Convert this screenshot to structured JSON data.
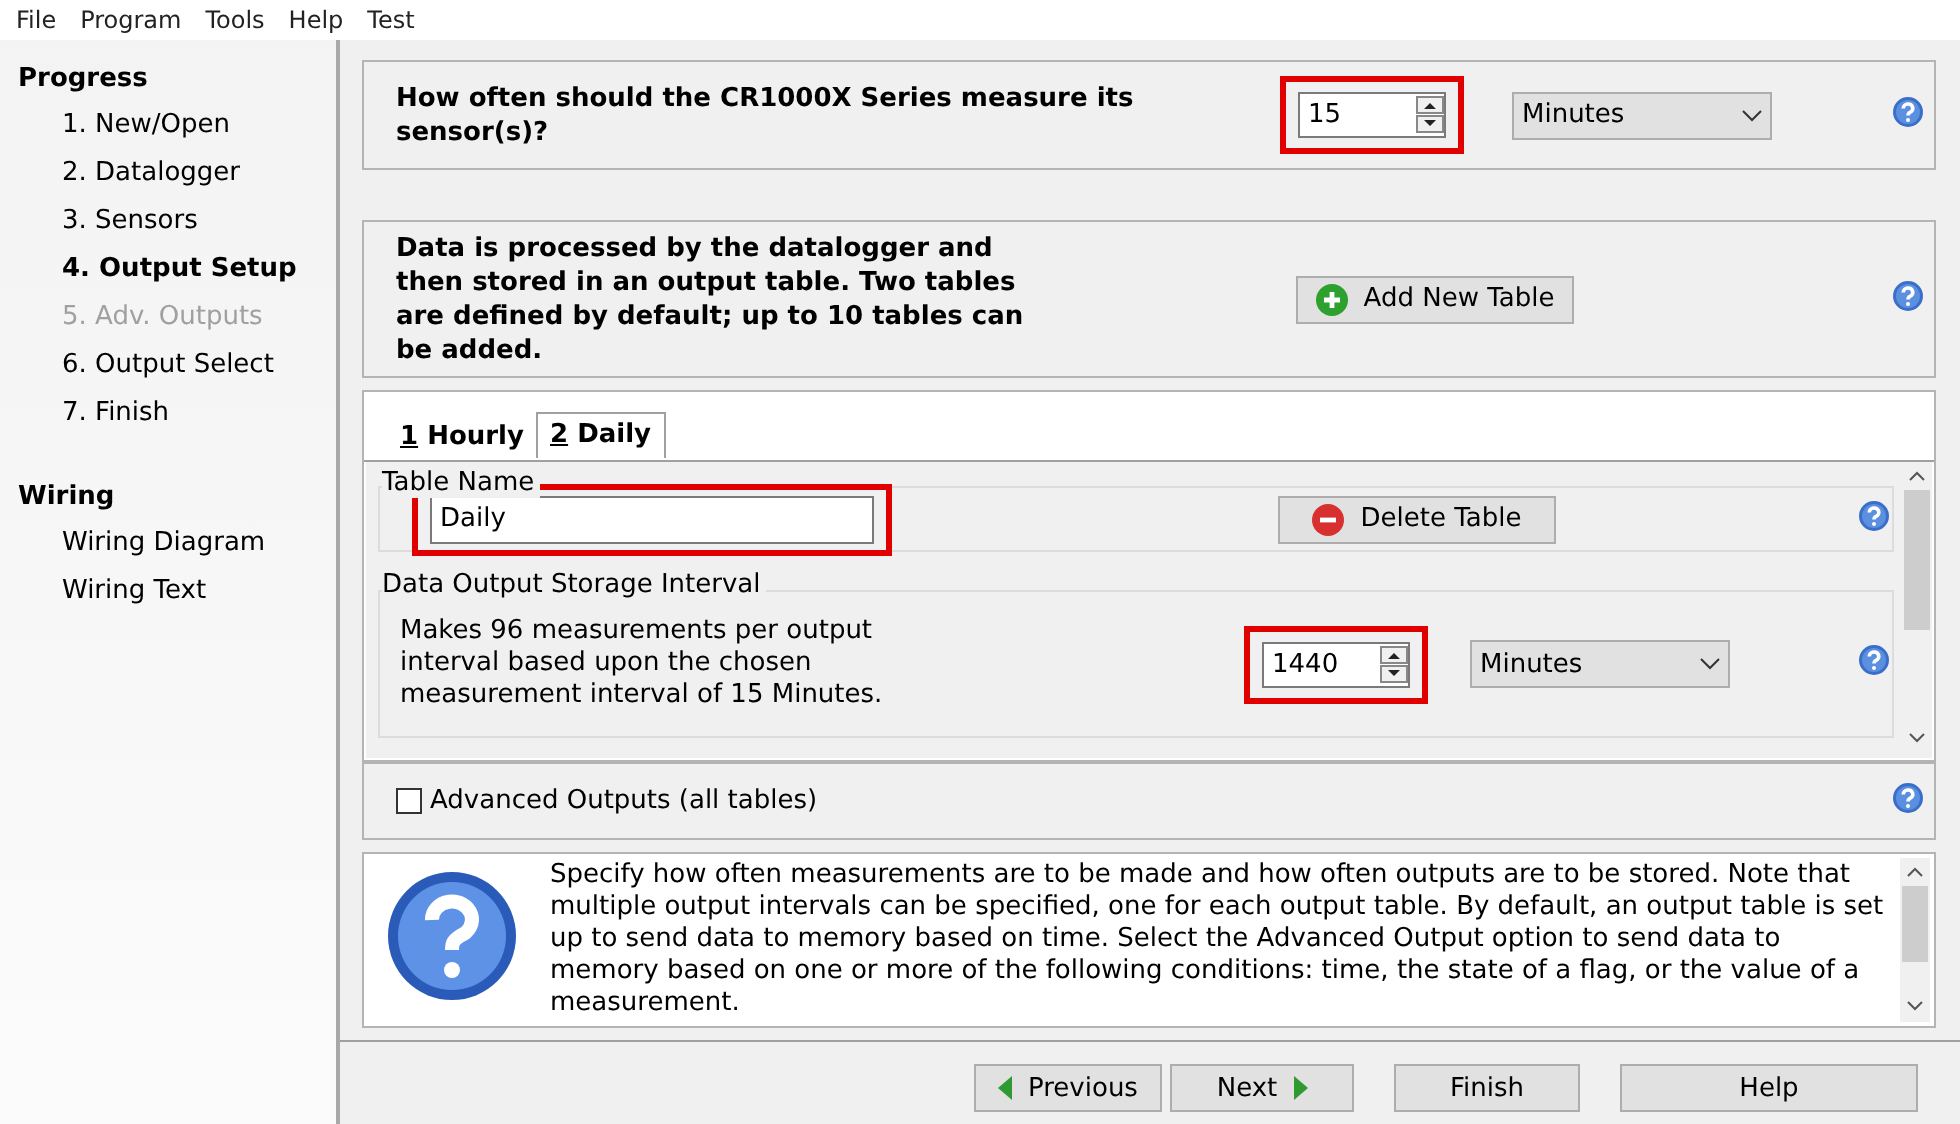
{
  "menu": [
    {
      "label": "File"
    },
    {
      "label": "Program"
    },
    {
      "label": "Tools"
    },
    {
      "label": "Help"
    },
    {
      "label": "Test"
    }
  ],
  "sidebar": {
    "sections": [
      {
        "title": "Progress",
        "items": [
          {
            "label": "1. New/Open",
            "selected": false,
            "disabled": false
          },
          {
            "label": "2. Datalogger",
            "selected": false,
            "disabled": false
          },
          {
            "label": "3. Sensors",
            "selected": false,
            "disabled": false
          },
          {
            "label": "4. Output Setup",
            "selected": true,
            "disabled": false
          },
          {
            "label": "5. Adv. Outputs",
            "selected": false,
            "disabled": true
          },
          {
            "label": "6. Output Select",
            "selected": false,
            "disabled": false
          },
          {
            "label": "7. Finish",
            "selected": false,
            "disabled": false
          }
        ]
      },
      {
        "title": "Wiring",
        "items": [
          {
            "label": "Wiring Diagram",
            "selected": false,
            "disabled": false
          },
          {
            "label": "Wiring Text",
            "selected": false,
            "disabled": false
          }
        ]
      }
    ]
  },
  "measurement": {
    "question": "How often should the CR1000X Series measure its sensor(s)?",
    "interval": {
      "value": "15",
      "highlighted": true
    },
    "units": "Minutes"
  },
  "tables_info": {
    "text": "Data is processed by the datalogger and then stored in an output table. Two tables are defined by default; up to 10 tables can be added.",
    "add_button": "Add New Table"
  },
  "tabs": [
    {
      "mnemonic": "1",
      "label": "Hourly",
      "selected": false
    },
    {
      "mnemonic": "2",
      "label": "Daily",
      "selected": true
    }
  ],
  "table_name": {
    "legend": "Table Name",
    "value": "Daily",
    "highlighted": true,
    "delete_button": "Delete Table"
  },
  "storage_interval": {
    "legend": "Data Output Storage Interval",
    "description": "Makes 96 measurements per output interval based upon the chosen measurement interval of 15 Minutes.",
    "interval": {
      "value": "1440",
      "highlighted": true
    },
    "units": "Minutes"
  },
  "advanced_outputs": {
    "label": "Advanced Outputs (all tables)",
    "checked": false
  },
  "help_text": "Specify how often measurements are to be made and how often outputs are to be stored. Note that multiple output intervals can be specified, one for each output table. By default, an output table is set up to send data to memory based on time. Select the Advanced Output option to send data to memory based on one or more of the following conditions: time, the state of a flag, or the value of a measurement.",
  "buttons": [
    {
      "kind": "previous",
      "label": "Previous"
    },
    {
      "kind": "next",
      "label": "Next"
    },
    {
      "kind": "plain",
      "label": "Finish"
    },
    {
      "kind": "plain",
      "label": "Help"
    }
  ]
}
